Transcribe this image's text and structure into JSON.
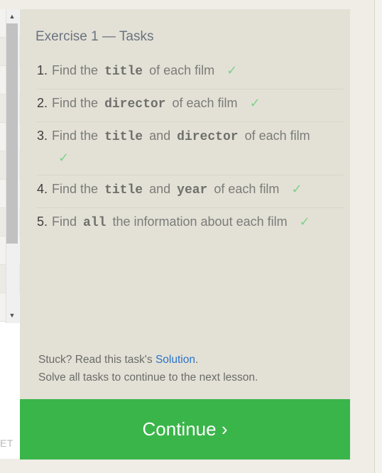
{
  "exercise": {
    "title": "Exercise 1 — Tasks"
  },
  "tasks": [
    {
      "num": "1.",
      "pre": "Find the",
      "kw1": "title",
      "mid": "",
      "kw2": "",
      "post": "of each film",
      "done": "✓"
    },
    {
      "num": "2.",
      "pre": "Find the",
      "kw1": "director",
      "mid": "",
      "kw2": "",
      "post": "of each film",
      "done": "✓"
    },
    {
      "num": "3.",
      "pre": "Find the",
      "kw1": "title",
      "mid": "and",
      "kw2": "director",
      "post": "of each film",
      "done": "✓"
    },
    {
      "num": "4.",
      "pre": "Find the",
      "kw1": "title",
      "mid": "and",
      "kw2": "year",
      "post": "of each film",
      "done": "✓"
    },
    {
      "num": "5.",
      "pre": "Find",
      "kw1": "all",
      "mid": "",
      "kw2": "",
      "post": "the information about each film",
      "done": "✓"
    }
  ],
  "footer": {
    "stuck_prefix": "Stuck? Read this task's",
    "solution_link": "Solution",
    "stuck_suffix": ".",
    "continue_note": "Solve all tasks to continue to the next lesson."
  },
  "continue_button": {
    "label": "Continue ›"
  },
  "left_pane": {
    "partial_label": "ET"
  },
  "colors": {
    "panel_bg": "#e3e1d6",
    "button_green": "#3ab54a",
    "check_green": "#7fd08a",
    "link_blue": "#2a73c7"
  }
}
